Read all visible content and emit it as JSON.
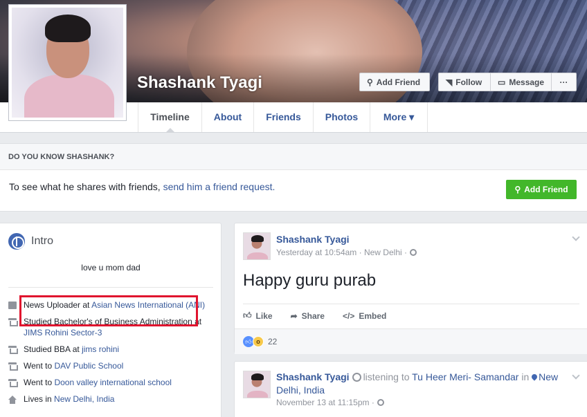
{
  "profile": {
    "name": "Shashank Tyagi",
    "buttons": {
      "add_friend": "Add Friend",
      "follow": "Follow",
      "message": "Message",
      "more": "···"
    }
  },
  "tabs": [
    "Timeline",
    "About",
    "Friends",
    "Photos",
    "More ▾"
  ],
  "active_tab": "Timeline",
  "do_you_know": {
    "heading": "DO YOU KNOW SHASHANK?",
    "text": "To see what he shares with friends,",
    "link": "send him a friend request.",
    "button": "Add Friend"
  },
  "intro": {
    "title": "Intro",
    "bio": "love u mom dad",
    "items": [
      {
        "icon": "briefcase-icon",
        "prefix": "News Uploader at ",
        "link": "Asian News International (ANI)"
      },
      {
        "icon": "graduation-cap-icon",
        "prefix": "Studied Bachelor's of Business Administration at ",
        "link": "JIMS Rohini Sector-3"
      },
      {
        "icon": "graduation-cap-icon",
        "prefix": "Studied BBA at ",
        "link": "jims rohini"
      },
      {
        "icon": "graduation-cap-icon",
        "prefix": "Went to ",
        "link": "DAV Public School"
      },
      {
        "icon": "graduation-cap-icon",
        "prefix": "Went to ",
        "link": "Doon valley international school"
      },
      {
        "icon": "home-icon",
        "prefix": "Lives in ",
        "link": "New Delhi, India"
      }
    ]
  },
  "posts": [
    {
      "author": "Shashank Tyagi",
      "meta": "Yesterday at 10:54am · New Delhi ·",
      "text": "Happy guru purab",
      "actions": [
        "Like",
        "Share",
        "Embed"
      ],
      "reaction_count": "22"
    },
    {
      "author": "Shashank Tyagi",
      "listening_prefix": "listening to",
      "song": "Tu Heer Meri- Samandar",
      "in_word": "in",
      "location": "New Delhi, India",
      "meta": "November 13 at 11:15pm ·"
    }
  ],
  "colors": {
    "link": "#365899",
    "green": "#42b72a",
    "highlight": "#e0132e",
    "background": "#e9ebee"
  }
}
